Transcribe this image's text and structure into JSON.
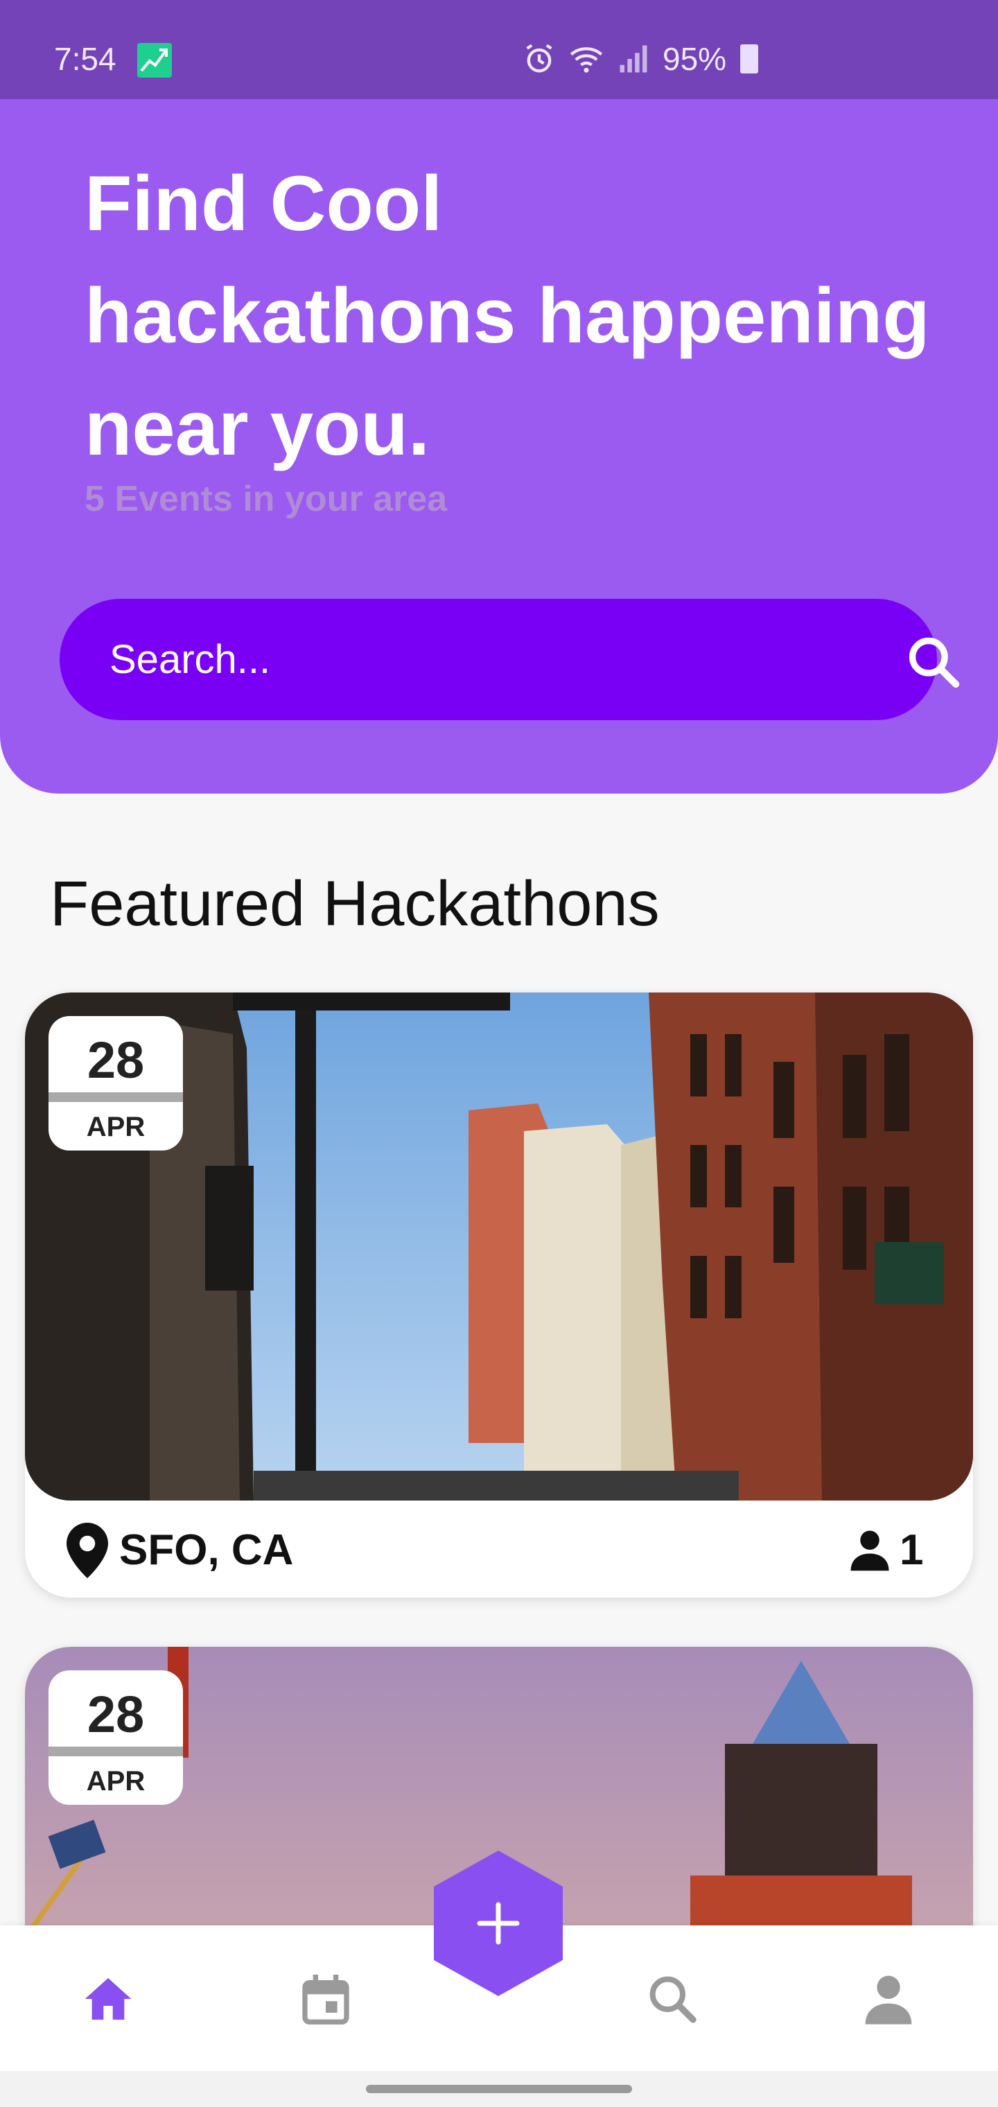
{
  "status_bar": {
    "time": "7:54",
    "battery": "95%",
    "icons": [
      "stocks-app-icon",
      "alarm-icon",
      "wifi-icon",
      "signal-icon",
      "battery-icon"
    ]
  },
  "hero": {
    "title_lines": [
      "Find Cool",
      "hackathons happening",
      "near you."
    ],
    "subtitle": "5 Events in your area",
    "search_placeholder": "Search..."
  },
  "section_title": "Featured Hackathons",
  "events": [
    {
      "day": "28",
      "month": "APR",
      "location": "SFO, CA",
      "attendees": "1"
    },
    {
      "day": "28",
      "month": "APR"
    }
  ],
  "nav": {
    "items": [
      "home",
      "calendar",
      "add",
      "search",
      "profile"
    ],
    "active": "home"
  },
  "colors": {
    "status_bar": "#7443b8",
    "hero": "#9b5af0",
    "search_bar": "#7a00f5",
    "accent": "#8a4ff0"
  }
}
